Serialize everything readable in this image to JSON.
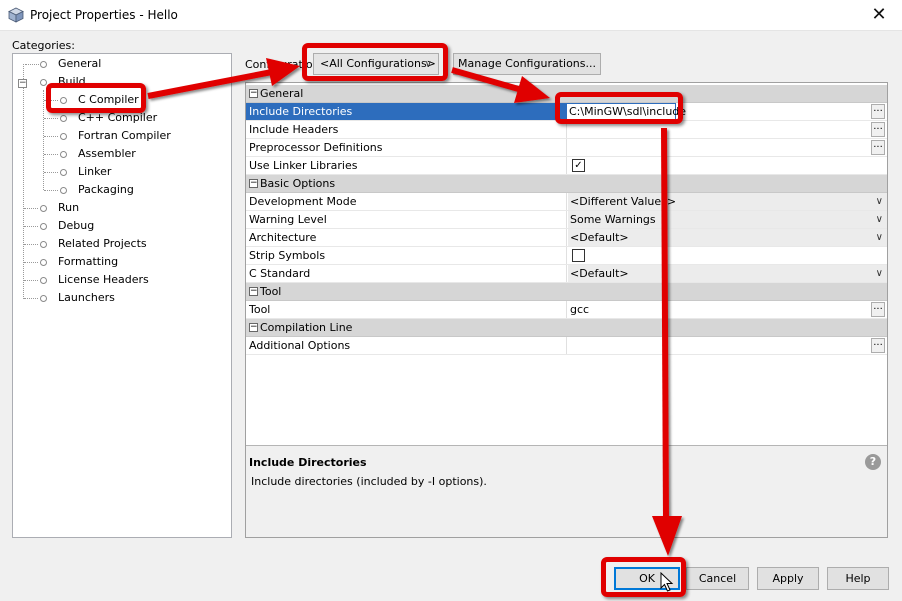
{
  "window": {
    "title": "Project Properties - Hello",
    "close_icon": "close-icon"
  },
  "categories": {
    "label": "Categories:",
    "items": [
      {
        "label": "General",
        "level": 1
      },
      {
        "label": "Build",
        "level": 1
      },
      {
        "label": "C Compiler",
        "level": 2,
        "selected": true
      },
      {
        "label": "C++ Compiler",
        "level": 2
      },
      {
        "label": "Fortran Compiler",
        "level": 2
      },
      {
        "label": "Assembler",
        "level": 2
      },
      {
        "label": "Linker",
        "level": 2
      },
      {
        "label": "Packaging",
        "level": 2
      },
      {
        "label": "Run",
        "level": 1
      },
      {
        "label": "Debug",
        "level": 1
      },
      {
        "label": "Related Projects",
        "level": 1
      },
      {
        "label": "Formatting",
        "level": 1
      },
      {
        "label": "License Headers",
        "level": 1
      },
      {
        "label": "Launchers",
        "level": 1
      }
    ]
  },
  "configuration": {
    "label": "Configuration:",
    "selected": "<All Configurations>",
    "manage_label": "Manage Configurations..."
  },
  "properties": {
    "general": {
      "header": "General",
      "include_directories": {
        "name": "Include Directories",
        "value": "C:\\MinGW\\sdl\\include"
      },
      "include_headers": {
        "name": "Include Headers",
        "value": ""
      },
      "preprocessor_definitions": {
        "name": "Preprocessor Definitions",
        "value": ""
      },
      "use_linker_libraries": {
        "name": "Use Linker Libraries",
        "checked": true
      }
    },
    "basic": {
      "header": "Basic Options",
      "development_mode": {
        "name": "Development Mode",
        "value": "<Different Values>"
      },
      "warning_level": {
        "name": "Warning Level",
        "value": "Some Warnings"
      },
      "architecture": {
        "name": "Architecture",
        "value": "<Default>"
      },
      "strip_symbols": {
        "name": "Strip Symbols",
        "checked": false
      },
      "c_standard": {
        "name": "C Standard",
        "value": "<Default>"
      }
    },
    "tool": {
      "header": "Tool",
      "tool": {
        "name": "Tool",
        "value": "gcc"
      }
    },
    "compilation": {
      "header": "Compilation Line",
      "additional_options": {
        "name": "Additional Options",
        "value": ""
      }
    }
  },
  "description": {
    "title": "Include Directories",
    "text": "Include directories (included by -I options).",
    "help_icon": "help-icon"
  },
  "buttons": {
    "ok": "OK",
    "cancel": "Cancel",
    "apply": "Apply",
    "help": "Help"
  },
  "ellipsis": "...",
  "checkmark": "✓",
  "collapse_glyph": "−",
  "annotation_color": "#e00000",
  "selection_color": "#2d6dbd"
}
